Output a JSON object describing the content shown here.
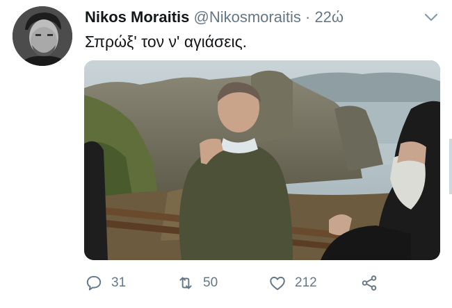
{
  "tweet": {
    "author_name": "Nikos Moraitis",
    "handle": "@Nikosmoraitis",
    "separator": "·",
    "timestamp": "22ώ",
    "text": "Σπρώξ' τον ν' αγιάσεις."
  },
  "actions": {
    "replies": "31",
    "retweets": "50",
    "likes": "212"
  },
  "icons": {
    "reply": "comment-icon",
    "retweet": "retweet-icon",
    "like": "heart-icon",
    "share": "share-icon",
    "menu": "chevron-down-icon"
  },
  "colors": {
    "text": "#14171a",
    "secondary": "#657786",
    "background": "#ffffff"
  }
}
